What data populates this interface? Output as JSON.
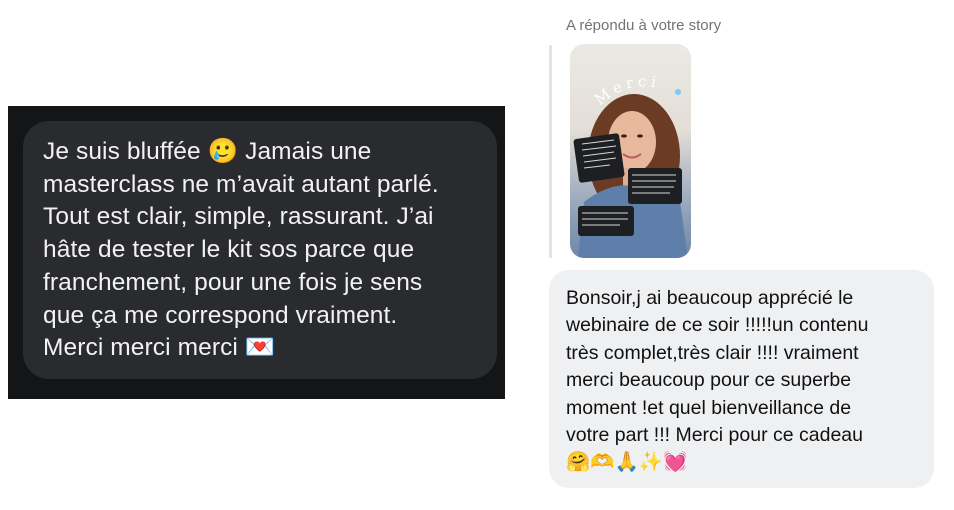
{
  "left_message": {
    "text": "Je suis bluffée 🥲  Jamais une\nmasterclass ne m’avait autant parlé.\nTout est clair, simple, rassurant. J’ai\nhâte de tester le kit sos parce que\nfranchement, pour une fois je sens\nque ça me correspond vraiment.\nMerci merci merci 💌"
  },
  "right_thread": {
    "reply_caption": "A répondu à votre story",
    "story": {
      "overlay_text": "Merci"
    },
    "message": "Bonsoir,j ai beaucoup apprécié le\nwebinaire de ce soir !!!!!un contenu\ntrès complet,très clair !!!! vraiment\nmerci beaucoup pour ce superbe\nmoment !et quel bienveillance de\nvotre part !!! Merci pour ce cadeau\n🤗🫶🙏✨💓"
  },
  "colors": {
    "dark_card_bg": "#141517",
    "dark_bubble": "#2a2b2e",
    "light_bubble": "#eff0f2",
    "caption_gray": "#737373"
  }
}
